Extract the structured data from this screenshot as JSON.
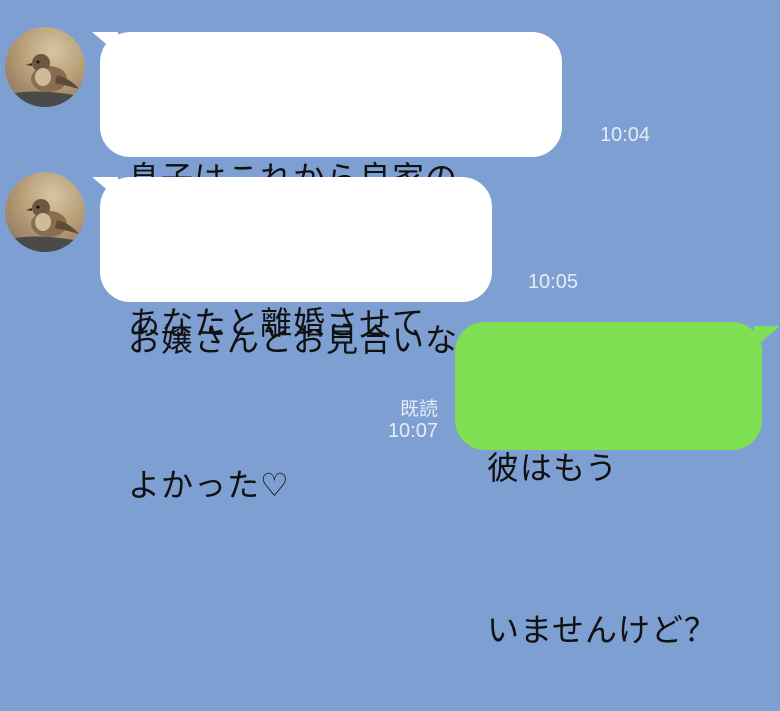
{
  "messages": [
    {
      "sender": "other",
      "lines": [
        "息子はこれから良家の",
        "お嬢さんとお見合いなの"
      ],
      "time": "10:04"
    },
    {
      "sender": "other",
      "lines": [
        "あなたと離婚させて",
        "よかった♡"
      ],
      "time": "10:05"
    },
    {
      "sender": "me",
      "lines": [
        "彼はもう",
        "いませんけど？"
      ],
      "time": "10:07",
      "read": "既読"
    }
  ],
  "colors": {
    "background": "#7d9fd2",
    "incoming_bubble": "#ffffff",
    "outgoing_bubble": "#7fe053"
  }
}
